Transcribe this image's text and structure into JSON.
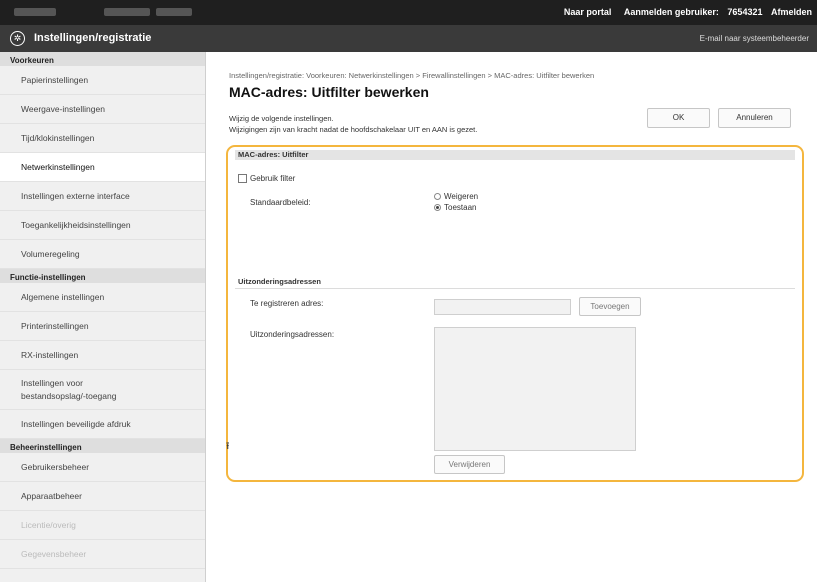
{
  "topbar": {
    "portal_link": "Naar portal",
    "login_label": "Aanmelden gebruiker:",
    "user_id": "7654321",
    "logout_link": "Afmelden"
  },
  "header": {
    "title": "Instellingen/registratie",
    "admin_mail_link": "E-mail naar systeembeheerder"
  },
  "sidebar": {
    "sections": [
      {
        "title": "Voorkeuren",
        "items": [
          {
            "label": "Papierinstellingen"
          },
          {
            "label": "Weergave-instellingen"
          },
          {
            "label": "Tijd/klokinstellingen"
          },
          {
            "label": "Netwerkinstellingen",
            "active": true
          },
          {
            "label": "Instellingen externe interface"
          },
          {
            "label": "Toegankelijkheidsinstellingen"
          },
          {
            "label": "Volumeregeling"
          }
        ]
      },
      {
        "title": "Functie-instellingen",
        "items": [
          {
            "label": "Algemene instellingen"
          },
          {
            "label": "Printerinstellingen"
          },
          {
            "label": "RX-instellingen"
          },
          {
            "label_line1": "Instellingen voor",
            "label_line2": "bestandsopslag/-toegang"
          },
          {
            "label": "Instellingen beveiligde afdruk"
          }
        ]
      },
      {
        "title": "Beheerinstellingen",
        "items": [
          {
            "label": "Gebruikersbeheer"
          },
          {
            "label": "Apparaatbeheer"
          },
          {
            "label": "Licentie/overig"
          },
          {
            "label": "Gegevensbeheer"
          }
        ]
      }
    ]
  },
  "main": {
    "breadcrumb": "Instellingen/registratie: Voorkeuren: Netwerkinstellingen > Firewallinstellingen > MAC-adres: Uitfilter bewerken",
    "title": "MAC-adres: Uitfilter bewerken",
    "info_line1": "Wijzig de volgende instellingen.",
    "info_line2": "Wijzigingen zijn van kracht nadat de hoofdschakelaar UIT en AAN is gezet.",
    "ok_button": "OK",
    "cancel_button": "Annuleren",
    "section_title": "MAC-adres: Uitfilter",
    "use_filter_label": "Gebruik filter",
    "use_filter_checked": false,
    "default_policy_label": "Standaardbeleid:",
    "policy_options": [
      "Weigeren",
      "Toestaan"
    ],
    "policy_selected": "Toestaan",
    "exceptions_title": "Uitzonderingsadressen",
    "register_label": "Te registreren adres:",
    "register_value": "",
    "add_button": "Toevoegen",
    "exceptions_label": "Uitzonderingsadressen:",
    "remove_button": "Verwijderen",
    "top_link_icon": "⭱"
  },
  "colors": {
    "highlight_border": "#f4b63e",
    "topbar": "#1f1f1f",
    "titlebar": "#3a3a3a"
  }
}
